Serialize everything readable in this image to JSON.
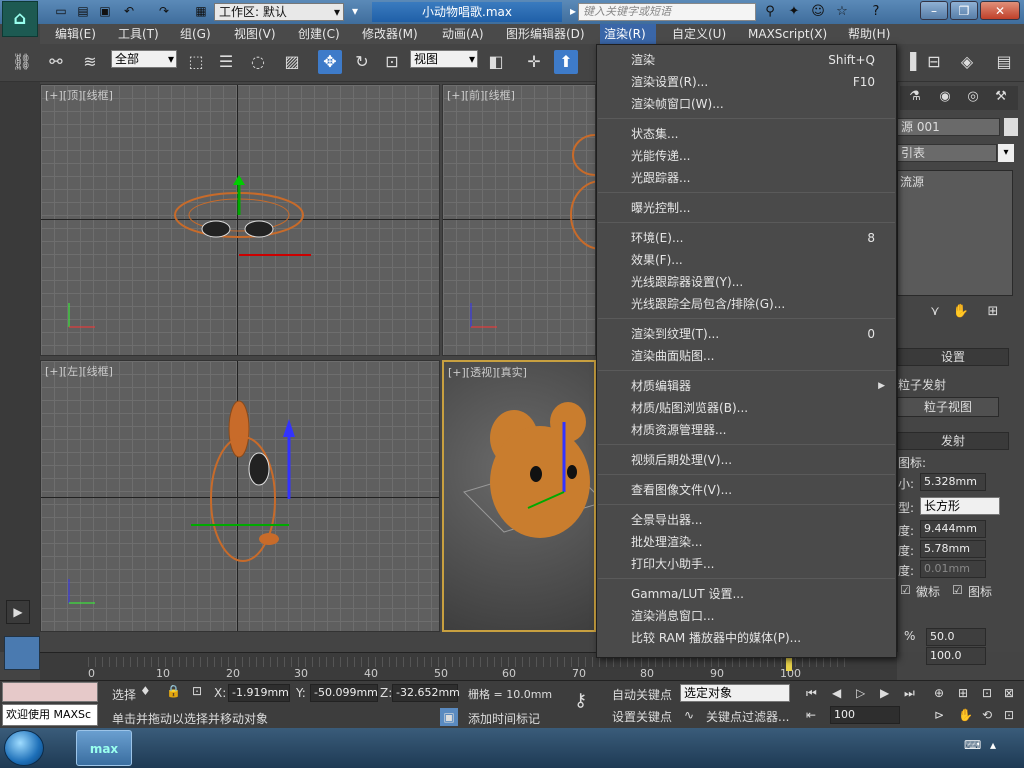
{
  "titlebar": {
    "workspace_label": "工作区: 默认",
    "document_title": "小动物唱歌.max",
    "search_placeholder": "键入关键字或短语"
  },
  "menubar": {
    "items": [
      "编辑(E)",
      "工具(T)",
      "组(G)",
      "视图(V)",
      "创建(C)",
      "修改器(M)",
      "动画(A)",
      "图形编辑器(D)",
      "渲染(R)",
      "自定义(U)",
      "MAXScript(X)",
      "帮助(H)"
    ]
  },
  "toolbar": {
    "selection_filter": "全部",
    "reference_coord": "视图"
  },
  "viewports": {
    "top": "[+][顶][线框]",
    "front": "[+][前][线框]",
    "left": "[+][左][线框]",
    "perspective": "[+][透视][真实]"
  },
  "render_menu": {
    "items": [
      {
        "label": "渲染",
        "shortcut": "Shift+Q"
      },
      {
        "label": "渲染设置(R)...",
        "shortcut": "F10"
      },
      {
        "label": "渲染帧窗口(W)...",
        "shortcut": ""
      },
      {
        "sep": true
      },
      {
        "label": "状态集...",
        "shortcut": ""
      },
      {
        "label": "光能传递...",
        "shortcut": ""
      },
      {
        "label": "光跟踪器...",
        "shortcut": ""
      },
      {
        "sep": true
      },
      {
        "label": "曝光控制...",
        "shortcut": ""
      },
      {
        "sep": true
      },
      {
        "label": "环境(E)...",
        "shortcut": "8"
      },
      {
        "label": "效果(F)...",
        "shortcut": ""
      },
      {
        "label": "光线跟踪器设置(Y)...",
        "shortcut": ""
      },
      {
        "label": "光线跟踪全局包含/排除(G)...",
        "shortcut": ""
      },
      {
        "sep": true
      },
      {
        "label": "渲染到纹理(T)...",
        "shortcut": "0"
      },
      {
        "label": "渲染曲面贴图...",
        "shortcut": ""
      },
      {
        "sep": true
      },
      {
        "label": "材质编辑器",
        "shortcut": "",
        "submenu": true
      },
      {
        "label": "材质/贴图浏览器(B)...",
        "shortcut": ""
      },
      {
        "label": "材质资源管理器...",
        "shortcut": ""
      },
      {
        "sep": true
      },
      {
        "label": "视频后期处理(V)...",
        "shortcut": ""
      },
      {
        "sep": true
      },
      {
        "label": "查看图像文件(V)...",
        "shortcut": ""
      },
      {
        "sep": true
      },
      {
        "label": "全景导出器...",
        "shortcut": ""
      },
      {
        "label": "批处理渲染...",
        "shortcut": ""
      },
      {
        "label": "打印大小助手...",
        "shortcut": ""
      },
      {
        "sep": true
      },
      {
        "label": "Gamma/LUT 设置...",
        "shortcut": ""
      },
      {
        "label": "渲染消息窗口...",
        "shortcut": ""
      },
      {
        "label": "比较 RAM 播放器中的媒体(P)...",
        "shortcut": ""
      }
    ]
  },
  "command_panel": {
    "object_name": "源 001",
    "list_label": "引表",
    "source_label": "流源",
    "settings_header": "设置",
    "particle_emit": "粒子发射",
    "particle_view": "粒子视图",
    "emit_header": "发射",
    "icon_label": "图标:",
    "size_label": "小:",
    "size_value": "5.328mm",
    "type_label": "型:",
    "type_value": "长方形",
    "length_label": "度:",
    "length_value": "9.444mm",
    "width_label": "度:",
    "width_value": "5.78mm",
    "height_label": "度:",
    "height_value": "0.01mm",
    "logo_check": "徽标",
    "icon_check": "图标",
    "view_pct_label": "%",
    "view_pct_value": "50.0",
    "render_pct_label": "%",
    "render_pct_value": "100.0"
  },
  "timeline": {
    "ticks": [
      "0",
      "10",
      "20",
      "30",
      "40",
      "50",
      "60",
      "70",
      "80",
      "90",
      "100"
    ]
  },
  "statusbar": {
    "welcome": "欢迎使用 MAXSc",
    "selection_label": "选择",
    "x_label": "X:",
    "x_value": "-1.919mm",
    "y_label": "Y:",
    "y_value": "-50.099mm",
    "z_label": "Z:",
    "z_value": "-32.652mm",
    "grid_label": "栅格 = 10.0mm",
    "hint": "单击并拖动以选择并移动对象",
    "add_time_tag": "添加时间标记",
    "auto_key": "自动关键点",
    "set_key": "设置关键点",
    "selected_object": "选定对象",
    "key_filter": "关键点过滤器...",
    "frame_value": "100"
  }
}
